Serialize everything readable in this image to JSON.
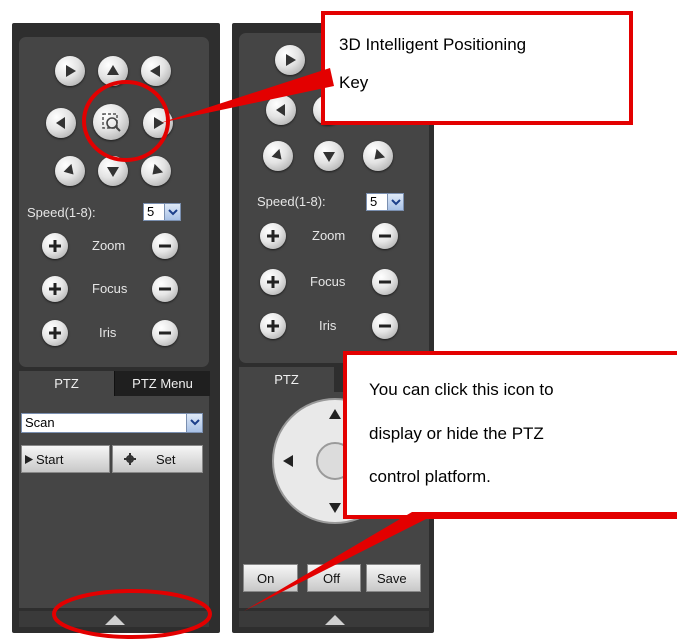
{
  "panels": [
    {
      "speed_label": "Speed(1-8):",
      "speed_value": "5",
      "zoom_label": "Zoom",
      "focus_label": "Focus",
      "iris_label": "Iris",
      "tab_ptz": "PTZ",
      "tab_ptz_menu": "PTZ Menu",
      "mode_value": "Scan",
      "start_label": "Start",
      "set_label": "Set"
    },
    {
      "speed_label": "Speed(1-8):",
      "speed_value": "5",
      "zoom_label": "Zoom",
      "focus_label": "Focus",
      "iris_label": "Iris",
      "tab_ptz": "PTZ",
      "on_label": "On",
      "off_label": "Off",
      "save_label": "Save"
    }
  ],
  "callouts": {
    "positioning_line1": "3D Intelligent Positioning",
    "positioning_line2": "Key",
    "toggle_line1": "You can click this icon to",
    "toggle_line2": "display or hide the PTZ",
    "toggle_line3": "control platform."
  },
  "colors": {
    "panel_bg": "#2e2e2e",
    "section_bg": "#454545",
    "annotation_red": "#e30000"
  },
  "icons": [
    "arrow-up-left-icon",
    "arrow-up-icon",
    "arrow-up-right-icon",
    "arrow-left-icon",
    "3d-position-icon",
    "arrow-right-icon",
    "arrow-down-left-icon",
    "arrow-down-icon",
    "arrow-down-right-icon",
    "plus-icon",
    "minus-icon",
    "play-icon",
    "gear-icon",
    "chevron-down-icon",
    "expand-arrow-icon"
  ]
}
